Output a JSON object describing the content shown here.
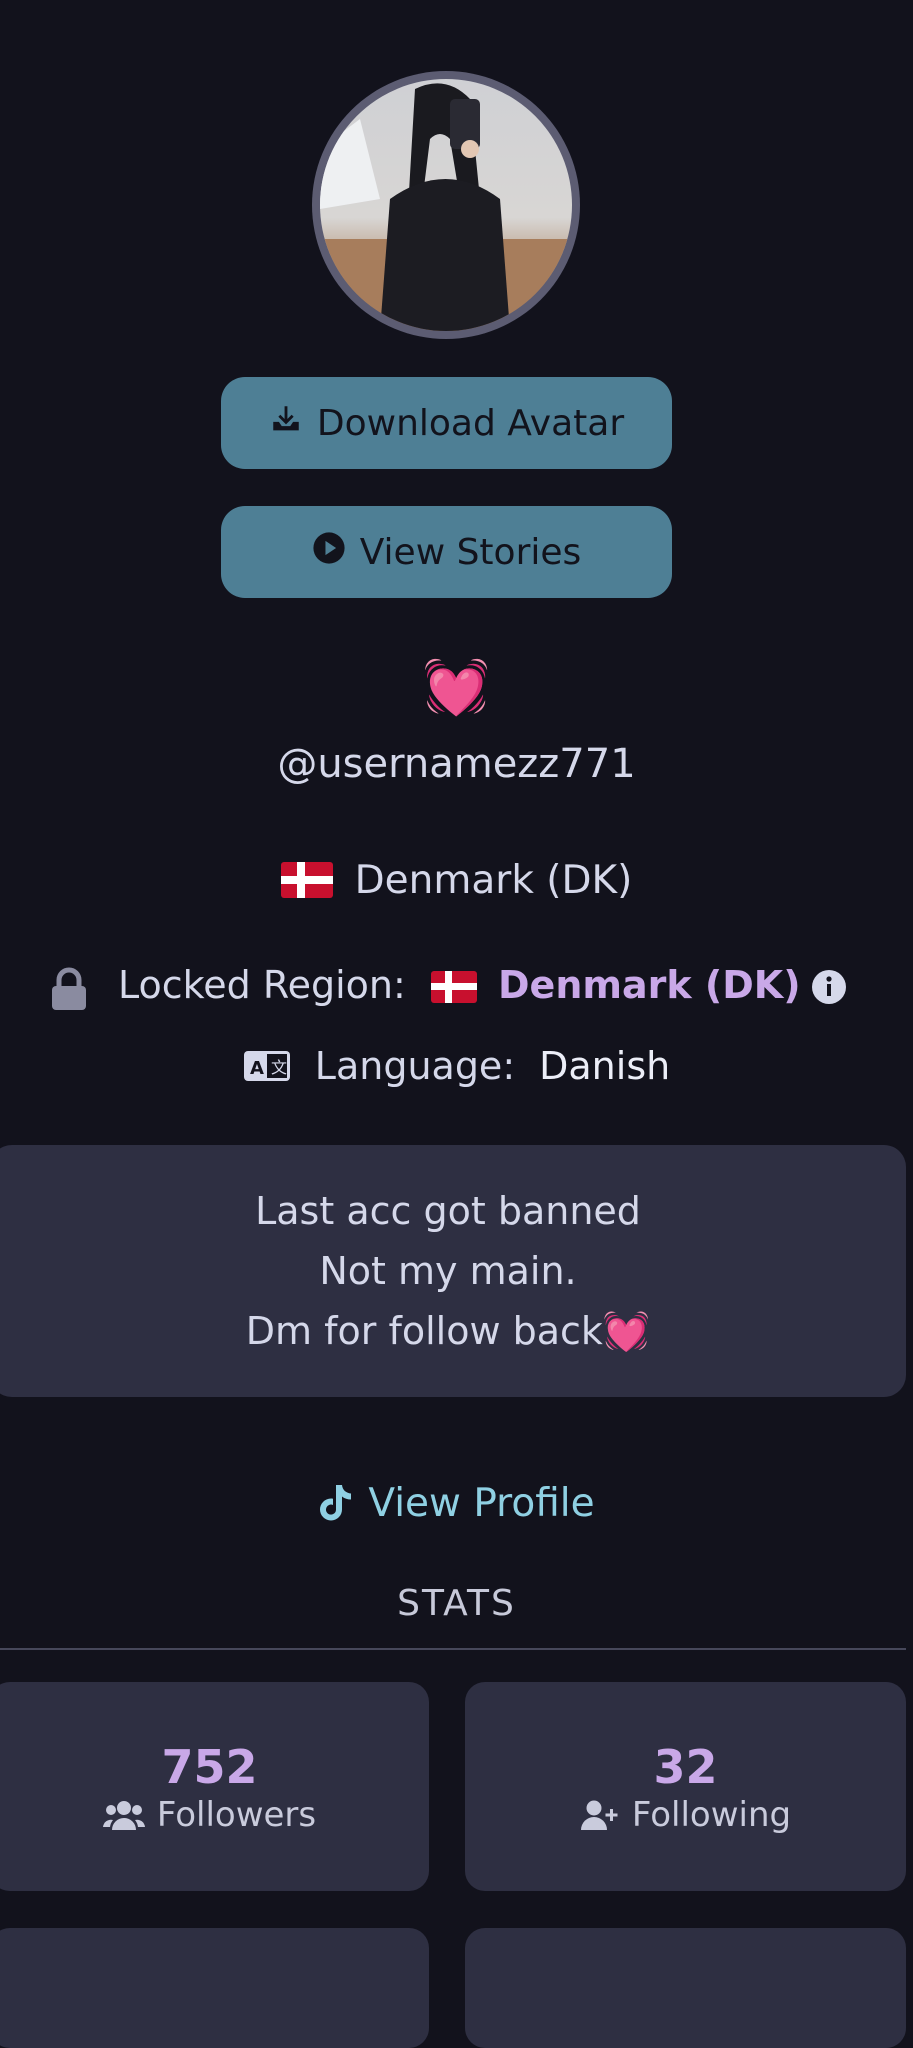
{
  "profile": {
    "avatar_alt": "profile avatar",
    "download_label": "Download Avatar",
    "stories_label": "View Stories",
    "emoji": "💓",
    "username": "@usernamezz771",
    "country": "Denmark (DK)"
  },
  "region": {
    "label": "Locked Region:",
    "value": "Denmark (DK)"
  },
  "language": {
    "label": "Language:",
    "value": "Danish"
  },
  "bio": {
    "lines": [
      "Last acc got banned",
      "Not my main.",
      "Dm for follow back💓"
    ]
  },
  "links": {
    "view_profile": "View Profile"
  },
  "stats": {
    "title": "STATS",
    "followers": {
      "value": "752",
      "label": "Followers"
    },
    "following": {
      "value": "32",
      "label": "Following"
    }
  },
  "colors": {
    "background": "#12121c",
    "button": "#4e7f95",
    "accent_purple": "#c9a8e8",
    "link": "#8fd0e3",
    "card": "#2e2f42"
  }
}
